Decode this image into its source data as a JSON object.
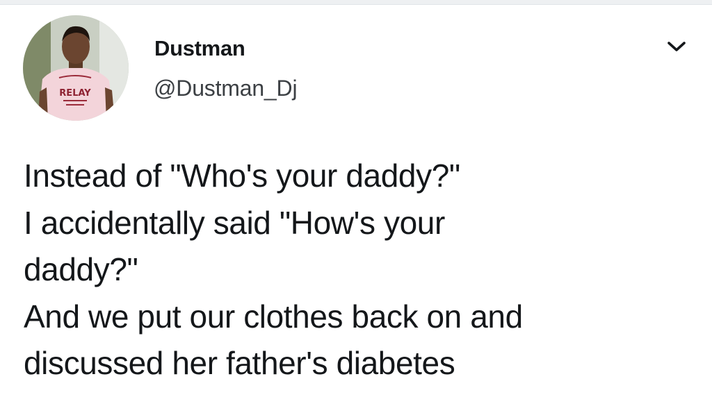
{
  "tweet": {
    "author": {
      "name": "Dustman",
      "handle": "@Dustman_Dj",
      "avatar_shirt_text": "RELAY"
    },
    "menu_icon": "chevron-down-icon",
    "text_lines": [
      "Instead of \"Who's your daddy?\"",
      "I accidentally said \"How's your",
      "daddy?\"",
      "And we put our clothes back on and",
      "discussed her father's diabetes"
    ]
  },
  "colors": {
    "background": "#ffffff",
    "text": "#14171a",
    "handle": "#3c4044"
  }
}
